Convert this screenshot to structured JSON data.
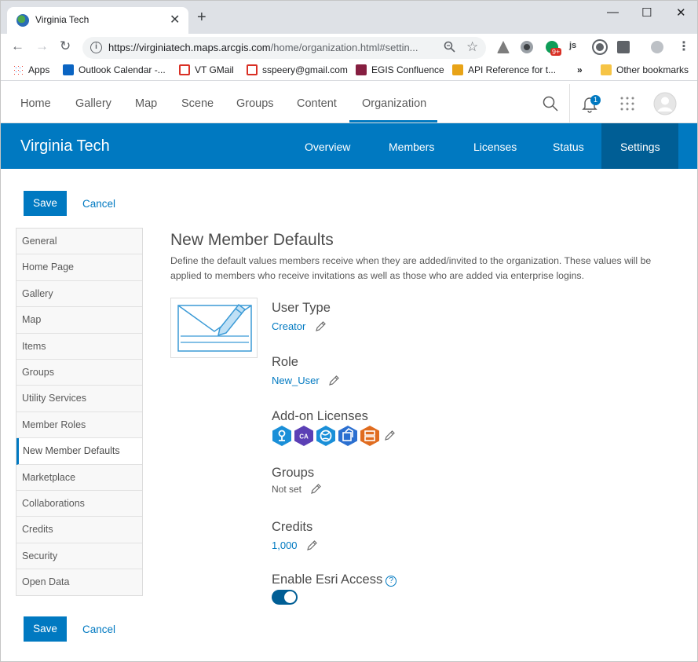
{
  "browser": {
    "tab_title": "Virginia Tech",
    "tab_close": "✕",
    "new_tab": "+",
    "url_host": "https://virginiatech.maps.arcgis.com",
    "url_path": "/home/organization.html#settin...",
    "badge_notifications": "9+",
    "window_controls": {
      "minimize": "—",
      "maximize": "☐",
      "close": "✕"
    }
  },
  "bookmarks": [
    {
      "label": "Apps",
      "color": "#4285f4"
    },
    {
      "label": "Outlook Calendar -...",
      "color": "#0a64c2"
    },
    {
      "label": "VT GMail",
      "color": "#d93025"
    },
    {
      "label": "sspeery@gmail.com",
      "color": "#d93025"
    },
    {
      "label": "EGIS Confluence",
      "color": "#861f41"
    },
    {
      "label": "API Reference for t...",
      "color": "#e8a317"
    }
  ],
  "bookmarks_more": "»",
  "bookmarks_other": "Other bookmarks",
  "topnav": {
    "items": [
      "Home",
      "Gallery",
      "Map",
      "Scene",
      "Groups",
      "Content",
      "Organization"
    ],
    "notification_count": "1"
  },
  "org": {
    "title": "Virginia Tech",
    "tabs": [
      "Overview",
      "Members",
      "Licenses",
      "Status",
      "Settings"
    ]
  },
  "actions": {
    "save": "Save",
    "cancel": "Cancel"
  },
  "sidenav": {
    "items": [
      "General",
      "Home Page",
      "Gallery",
      "Map",
      "Items",
      "Groups",
      "Utility Services",
      "Member Roles",
      "New Member Defaults",
      "Marketplace",
      "Collaborations",
      "Credits",
      "Security",
      "Open Data"
    ],
    "active": "New Member Defaults"
  },
  "content": {
    "title": "New Member Defaults",
    "description": "Define the default values members receive when they are added/invited to the organization. These values will be applied to members who receive invitations as well as those who are added via enterprise logins.",
    "user_type": {
      "label": "User Type",
      "value": "Creator"
    },
    "role": {
      "label": "Role",
      "value": "New_User"
    },
    "addon_licenses": {
      "label": "Add-on Licenses",
      "icons": [
        {
          "name": "navigator-license-icon",
          "color": "#1a8fd8"
        },
        {
          "name": "community-analyst-license-icon",
          "color": "#5b3fb5",
          "text": "CA"
        },
        {
          "name": "arcgis-earth-license-icon",
          "color": "#1a8fd8"
        },
        {
          "name": "drone2map-license-icon",
          "color": "#2b6fd0"
        },
        {
          "name": "workforce-license-icon",
          "color": "#e06c1f"
        }
      ]
    },
    "groups": {
      "label": "Groups",
      "value": "Not set"
    },
    "credits": {
      "label": "Credits",
      "value": "1,000"
    },
    "esri_access": {
      "label": "Enable Esri Access",
      "help": "?",
      "enabled": true
    }
  }
}
